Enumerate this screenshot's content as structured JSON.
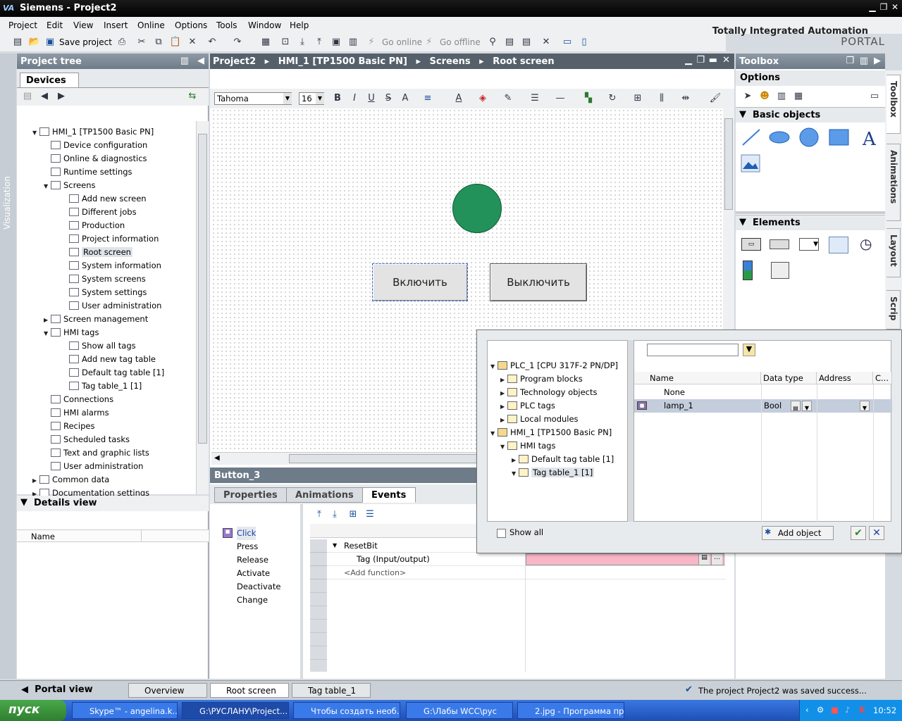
{
  "window": {
    "title": "Siemens  -  Project2",
    "logo": "VA"
  },
  "menu": [
    "Project",
    "Edit",
    "View",
    "Insert",
    "Online",
    "Options",
    "Tools",
    "Window",
    "Help"
  ],
  "brand": {
    "line1": "Totally Integrated Automation",
    "line2": "PORTAL"
  },
  "toolbar": {
    "save_label": "Save project",
    "go_online": "Go online",
    "go_offline": "Go offline"
  },
  "left_strip": {
    "label": "Visualization"
  },
  "project_tree": {
    "title": "Project tree",
    "tab": "Devices",
    "nodes": [
      {
        "label": "HMI_1 [TP1500 Basic PN]",
        "level": 0,
        "tw": "▼"
      },
      {
        "label": "Device configuration",
        "level": 1
      },
      {
        "label": "Online & diagnostics",
        "level": 1
      },
      {
        "label": "Runtime settings",
        "level": 1
      },
      {
        "label": "Screens",
        "level": 1,
        "tw": "▼"
      },
      {
        "label": "Add new screen",
        "level": 2
      },
      {
        "label": "Different jobs",
        "level": 2
      },
      {
        "label": "Production",
        "level": 2
      },
      {
        "label": "Project information",
        "level": 2
      },
      {
        "label": "Root screen",
        "level": 2,
        "selected": true
      },
      {
        "label": "System information",
        "level": 2
      },
      {
        "label": "System screens",
        "level": 2
      },
      {
        "label": "System settings",
        "level": 2
      },
      {
        "label": "User administration",
        "level": 2
      },
      {
        "label": "Screen management",
        "level": 1,
        "tw": "▶"
      },
      {
        "label": "HMI tags",
        "level": 1,
        "tw": "▼"
      },
      {
        "label": "Show all tags",
        "level": 2
      },
      {
        "label": "Add new tag table",
        "level": 2
      },
      {
        "label": "Default tag table [1]",
        "level": 2
      },
      {
        "label": "Tag table_1 [1]",
        "level": 2
      },
      {
        "label": "Connections",
        "level": 1
      },
      {
        "label": "HMI alarms",
        "level": 1
      },
      {
        "label": "Recipes",
        "level": 1
      },
      {
        "label": "Scheduled tasks",
        "level": 1
      },
      {
        "label": "Text and graphic lists",
        "level": 1
      },
      {
        "label": "User administration",
        "level": 1
      },
      {
        "label": "Common data",
        "level": 0,
        "tw": "▶"
      },
      {
        "label": "Documentation settings",
        "level": 0,
        "tw": "▶"
      }
    ]
  },
  "details": {
    "title": "Details view",
    "col_name": "Name"
  },
  "editor": {
    "breadcrumb": [
      "Project2",
      "HMI_1 [TP1500 Basic PN]",
      "Screens",
      "Root screen"
    ],
    "font": "Tahoma",
    "font_size": "16",
    "btn_on": "Включить",
    "btn_off": "Выключить"
  },
  "properties": {
    "object": "Button_3",
    "tabs": [
      "Properties",
      "Animations",
      "Events"
    ],
    "events": [
      "Click",
      "Press",
      "Release",
      "Activate",
      "Deactivate",
      "Change"
    ],
    "function": "ResetBit",
    "param": "Tag (Input/output)",
    "add_function": "<Add function>"
  },
  "toolbox": {
    "title": "Toolbox",
    "options": "Options",
    "basic_objects": "Basic objects",
    "elements": "Elements",
    "side_tabs": [
      "Toolbox",
      "Animations",
      "Layout",
      "Scrip"
    ]
  },
  "popup": {
    "tree": [
      {
        "label": "PLC_1 [CPU 317F-2 PN/DP]",
        "level": 0,
        "tw": "▼"
      },
      {
        "label": "Program blocks",
        "level": 1,
        "tw": "▶"
      },
      {
        "label": "Technology objects",
        "level": 1,
        "tw": "▶"
      },
      {
        "label": "PLC tags",
        "level": 1,
        "tw": "▶"
      },
      {
        "label": "Local modules",
        "level": 1,
        "tw": "▶"
      },
      {
        "label": "HMI_1 [TP1500 Basic PN]",
        "level": 0,
        "tw": "▼"
      },
      {
        "label": "HMI tags",
        "level": 1,
        "tw": "▼"
      },
      {
        "label": "Default tag table [1]",
        "level": 2,
        "tw": "▶"
      },
      {
        "label": "Tag table_1 [1]",
        "level": 2,
        "tw": "▼",
        "selected": true
      }
    ],
    "columns": {
      "name": "Name",
      "type": "Data type",
      "address": "Address",
      "c": "C..."
    },
    "rows": [
      {
        "name": "None",
        "type": ""
      },
      {
        "name": "lamp_1",
        "type": "Bool"
      }
    ],
    "show_all": "Show all",
    "add_object": "Add object"
  },
  "statusbar": {
    "portal": "Portal view",
    "tabs": [
      "Overview",
      "Root screen",
      "Tag table_1"
    ],
    "message": "The project Project2 was saved success..."
  },
  "taskbar": {
    "start": "пуск",
    "items": [
      "Skype™ - angelina.k...",
      "G:\\РУСЛАНУ\\Project...",
      "Чтобы создать необ...",
      "G:\\Лабы WCC\\рус",
      "2.jpg - Программа пр..."
    ],
    "clock": "10:52"
  },
  "colors": {
    "lamp": "#22925a",
    "selection": "#c4cddc",
    "tag_missing": "#f7b7c7"
  }
}
